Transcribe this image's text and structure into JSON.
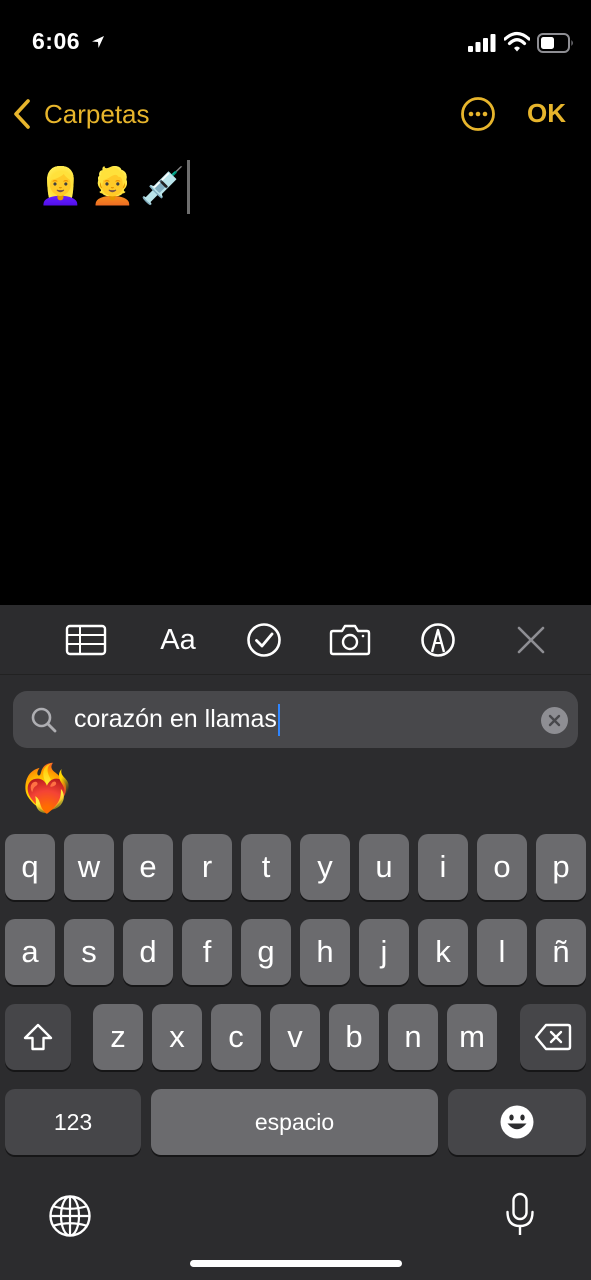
{
  "status": {
    "time": "6:06"
  },
  "nav": {
    "back_label": "Carpetas",
    "done_label": "OK"
  },
  "note": {
    "emojis": [
      "👱‍♀️",
      "👱",
      "💉"
    ]
  },
  "toolbar": {
    "format_label": "Aa"
  },
  "search": {
    "query": "corazón en llamas"
  },
  "results": [
    "❤️‍🔥"
  ],
  "keyboard": {
    "row1": [
      "q",
      "w",
      "e",
      "r",
      "t",
      "y",
      "u",
      "i",
      "o",
      "p"
    ],
    "row2": [
      "a",
      "s",
      "d",
      "f",
      "g",
      "h",
      "j",
      "k",
      "l",
      "ñ"
    ],
    "row3": [
      "z",
      "x",
      "c",
      "v",
      "b",
      "n",
      "m"
    ],
    "numbers_label": "123",
    "space_label": "espacio"
  },
  "colors": {
    "accent": "#e7b52c",
    "cursor": "#2f86ff"
  }
}
